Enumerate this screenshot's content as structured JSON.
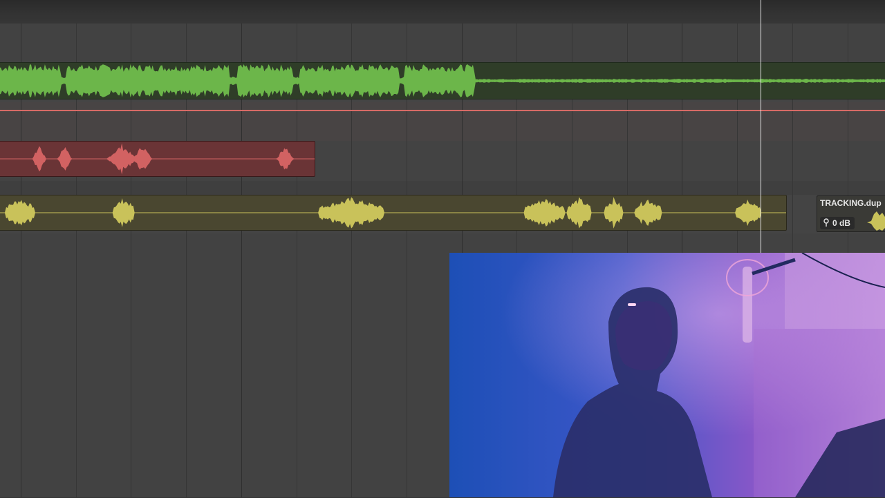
{
  "colors": {
    "green_clip": "#6cb64a",
    "red_clip": "#d26262",
    "yellow_clip": "#c9c25a",
    "playhead": "#e8e8e8",
    "track_separator": "#d76a66"
  },
  "clips": {
    "tracking": {
      "name": "TRACKING.dup",
      "gain": "0 dB",
      "gain_icon": "gain-knob-icon"
    }
  },
  "video_overlay": {
    "description_icon": "video-thumbnail"
  }
}
